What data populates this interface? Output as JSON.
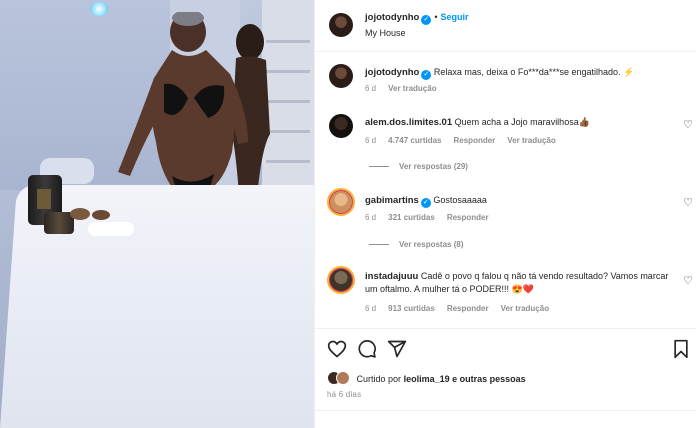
{
  "post": {
    "username": "jojotodynho",
    "follow_label": "Seguir",
    "dot": "•",
    "location": "My House"
  },
  "caption": {
    "username": "jojotodynho",
    "text": "Relaxa mas, deixa o Fo***da***se engatilhado. ⚡",
    "age": "6 d",
    "translate": "Ver tradução"
  },
  "comments": [
    {
      "username": "alem.dos.limites.01",
      "text": "Quem acha a Jojo maravilhosa👍🏾",
      "age": "6 d",
      "likes": "4.747 curtidas",
      "reply": "Responder",
      "translate": "Ver tradução",
      "view_replies": "Ver respostas (29)"
    },
    {
      "username": "gabimartins",
      "text": "Gostosaaaaa",
      "age": "6 d",
      "likes": "321 curtidas",
      "reply": "Responder",
      "view_replies": "Ver respostas (8)"
    },
    {
      "username": "instadajuuu",
      "text": "Cadê o povo q falou q não tá vendo resultado? Vamos marcar um oftalmo. A mulher tá o PODER!!! 😍❤️",
      "age": "6 d",
      "likes": "913 curtidas",
      "reply": "Responder",
      "translate": "Ver tradução"
    }
  ],
  "likes_line": {
    "prefix": "Curtido por",
    "user": "leolima_19",
    "suffix": "e outras pessoas"
  },
  "date": "há 6 dias",
  "colors": {
    "accent": "#0095f6",
    "text": "#262626",
    "muted": "#8e8e8e",
    "border": "#efefef"
  },
  "icons": [
    "heart-icon",
    "comment-icon",
    "share-icon",
    "bookmark-icon",
    "verified-icon",
    "more-icon"
  ]
}
